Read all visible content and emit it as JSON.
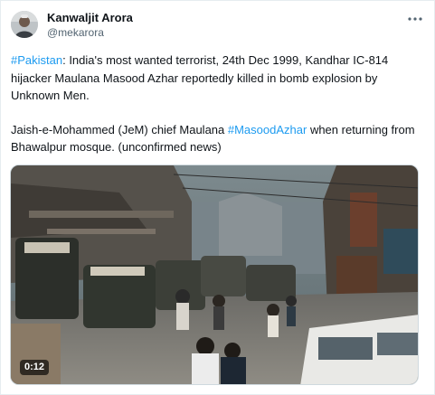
{
  "author": {
    "display_name": "Kanwaljit Arora",
    "handle": "@mekarora"
  },
  "tweet": {
    "hashtag_pakistan": "#Pakistan",
    "line1_rest": ": India's most wanted terrorist, 24th Dec 1999, Kandhar IC-814 hijacker Maulana Masood Azhar reportedly killed in bomb explosion by Unknown Men.",
    "line2_start": "Jaish-e-Mohammed (JeM) chief Maulana ",
    "hashtag_masood": "#MasoodAzhar",
    "line2_rest": " when returning from Bhawalpur mosque. (unconfirmed news)"
  },
  "media": {
    "type": "video",
    "duration": "0:12"
  },
  "colors": {
    "link": "#1d9bf0",
    "text": "#0f1419",
    "secondary": "#536471",
    "border": "#cfd9de"
  },
  "icons": {
    "more": "ellipsis-icon",
    "avatar": "avatar"
  }
}
